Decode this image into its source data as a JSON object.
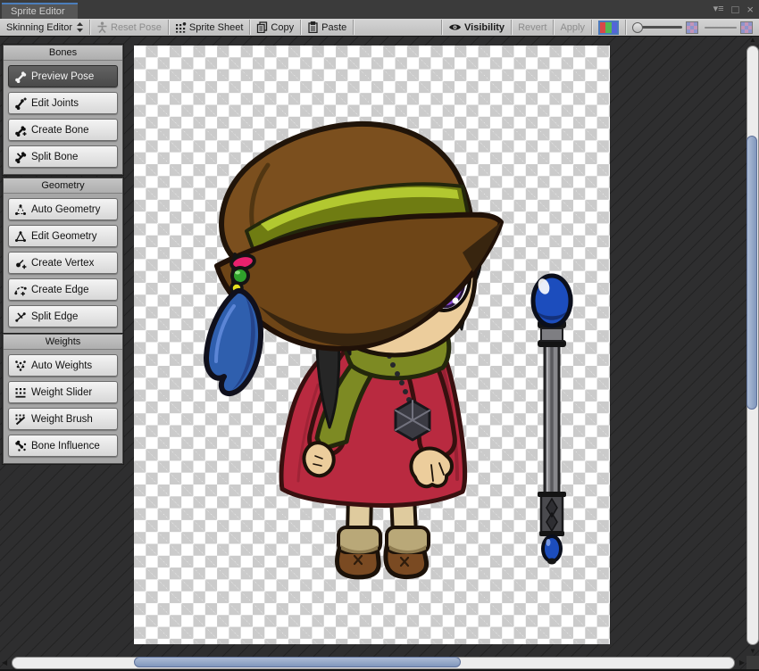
{
  "window": {
    "tab_title": "Sprite Editor",
    "controls": {
      "menu": "▾≡",
      "maximize": "□",
      "close": "×"
    }
  },
  "toolbar": {
    "mode_dropdown": "Skinning Editor",
    "reset_pose": "Reset Pose",
    "sprite_sheet": "Sprite Sheet",
    "copy": "Copy",
    "paste": "Paste",
    "visibility": "Visibility",
    "revert": "Revert",
    "apply": "Apply"
  },
  "panels": {
    "bones": {
      "title": "Bones",
      "buttons": [
        {
          "label": "Preview Pose",
          "icon": "bone-icon",
          "selected": true
        },
        {
          "label": "Edit Joints",
          "icon": "bone-joint-icon",
          "selected": false
        },
        {
          "label": "Create Bone",
          "icon": "bone-add-icon",
          "selected": false
        },
        {
          "label": "Split Bone",
          "icon": "bone-split-icon",
          "selected": false
        }
      ]
    },
    "geometry": {
      "title": "Geometry",
      "buttons": [
        {
          "label": "Auto Geometry",
          "icon": "mesh-auto-icon",
          "selected": false
        },
        {
          "label": "Edit Geometry",
          "icon": "mesh-edit-icon",
          "selected": false
        },
        {
          "label": "Create Vertex",
          "icon": "vertex-add-icon",
          "selected": false
        },
        {
          "label": "Create Edge",
          "icon": "edge-add-icon",
          "selected": false
        },
        {
          "label": "Split Edge",
          "icon": "edge-split-icon",
          "selected": false
        }
      ]
    },
    "weights": {
      "title": "Weights",
      "buttons": [
        {
          "label": "Auto Weights",
          "icon": "weights-auto-icon",
          "selected": false
        },
        {
          "label": "Weight Slider",
          "icon": "weight-slider-icon",
          "selected": false
        },
        {
          "label": "Weight Brush",
          "icon": "weight-brush-icon",
          "selected": false
        },
        {
          "label": "Bone Influence",
          "icon": "bone-influence-icon",
          "selected": false
        }
      ]
    }
  },
  "canvas": {
    "content": "Chibi witch girl sprite (brown pointed hat with olive band, beads and blue feather, black hair, large purple eyes, olive scarf, red dress with cube pendant necklace, tan boots) and a gray magic staff with blue gems, on transparent checkerboard"
  },
  "palette": {
    "accent_blue": "#4c7ebb",
    "toolbar_bg": "#c6c6c6",
    "panel_bg": "#a6a6a6",
    "editor_bg": "#2e2e2f",
    "scroll_thumb": "#8c9fbe",
    "hat_brown": "#6e4517",
    "hat_band_olive": "#8a9a1e",
    "dress_red": "#b92a40",
    "scarf_olive": "#7d8a23",
    "skin": "#eccd9c",
    "eye_purple": "#8b48d8",
    "gem_blue": "#1c4dbd"
  }
}
